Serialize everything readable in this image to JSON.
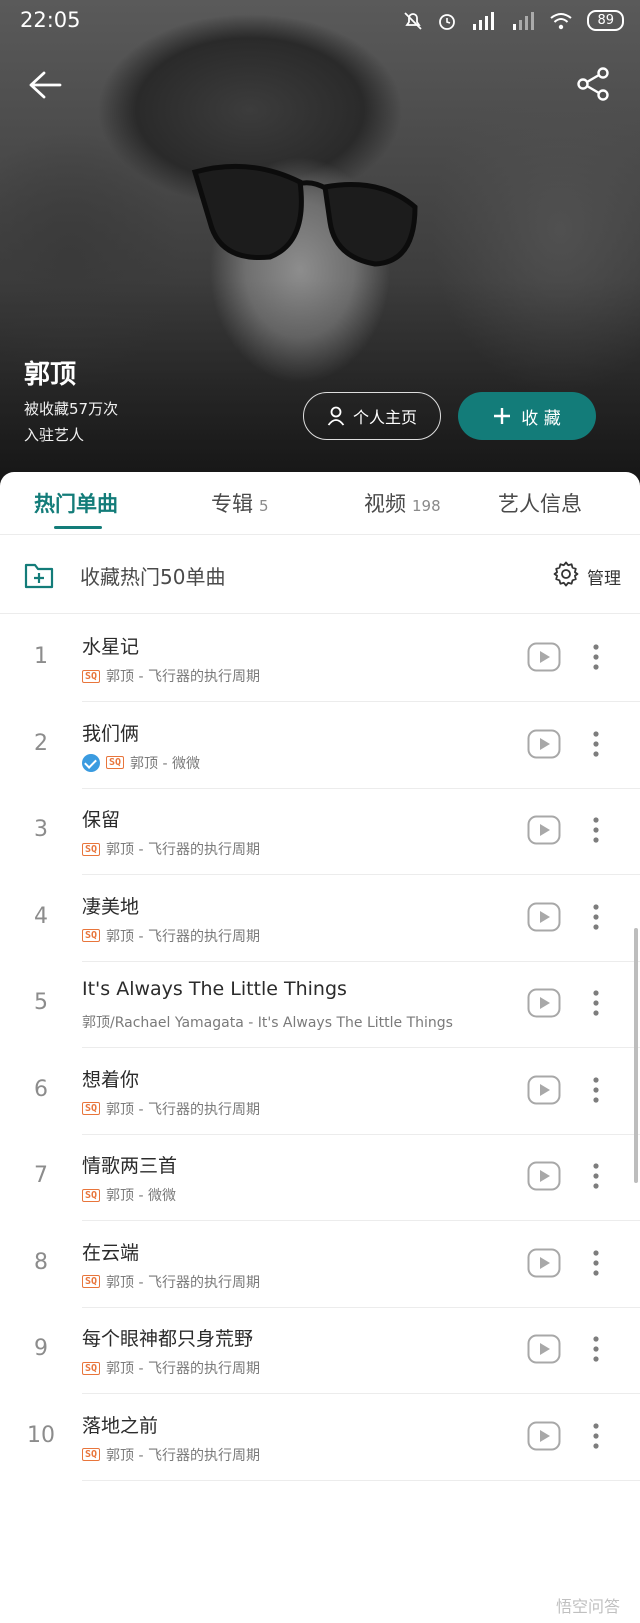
{
  "status_bar": {
    "time": "22:05",
    "battery": "89"
  },
  "artist": {
    "name": "郭顶",
    "favorites": "被收藏57万次",
    "role": "入驻艺人"
  },
  "actions": {
    "profile_label": "个人主页",
    "favorite_label": "收 藏"
  },
  "tabs": [
    {
      "label": "热门单曲",
      "count": ""
    },
    {
      "label": "专辑",
      "count": "5"
    },
    {
      "label": "视频",
      "count": "198"
    },
    {
      "label": "艺人信息",
      "count": ""
    }
  ],
  "collect_row": {
    "label": "收藏热门50单曲",
    "manage_label": "管理"
  },
  "songs": [
    {
      "num": "1",
      "title": "水星记",
      "meta": "郭顶 - 飞行器的执行周期",
      "sq": "SQ",
      "verified": false
    },
    {
      "num": "2",
      "title": "我们俩",
      "meta": "郭顶 - 微微",
      "sq": "SQ",
      "verified": true
    },
    {
      "num": "3",
      "title": "保留",
      "meta": "郭顶 - 飞行器的执行周期",
      "sq": "SQ",
      "verified": false
    },
    {
      "num": "4",
      "title": "凄美地",
      "meta": "郭顶 - 飞行器的执行周期",
      "sq": "SQ",
      "verified": false
    },
    {
      "num": "5",
      "title": "It's Always The Little Things",
      "meta": "郭顶/Rachael Yamagata - It's Always The Little Things",
      "sq": "",
      "verified": false
    },
    {
      "num": "6",
      "title": "想着你",
      "meta": "郭顶 - 飞行器的执行周期",
      "sq": "SQ",
      "verified": false
    },
    {
      "num": "7",
      "title": "情歌两三首",
      "meta": "郭顶 - 微微",
      "sq": "SQ",
      "verified": false
    },
    {
      "num": "8",
      "title": "在云端",
      "meta": "郭顶 - 飞行器的执行周期",
      "sq": "SQ",
      "verified": false
    },
    {
      "num": "9",
      "title": "每个眼神都只身荒野",
      "meta": "郭顶 - 飞行器的执行周期",
      "sq": "SQ",
      "verified": false
    },
    {
      "num": "10",
      "title": "落地之前",
      "meta": "郭顶 - 飞行器的执行周期",
      "sq": "SQ",
      "verified": false
    }
  ],
  "watermark": "悟空问答",
  "colors": {
    "accent": "#137c79",
    "sq_badge": "#e8753b",
    "verified": "#3a9be0"
  }
}
